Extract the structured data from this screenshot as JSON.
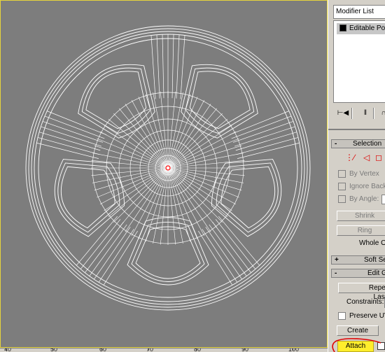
{
  "viewport": {
    "ruler_labels": [
      "40",
      "50",
      "60",
      "70",
      "80",
      "90",
      "100"
    ],
    "line_color": "#ffffff",
    "background": "#7d7d7d",
    "pivot_color": "#ff0000",
    "border_color": "#e6d43c"
  },
  "command_panel": {
    "modifier_list": {
      "label": "Modifier List"
    },
    "modifier_stack": {
      "item_label": "Editable Poly"
    },
    "toolbar_icons": [
      "pin-stack-icon",
      "show-end-result-icon",
      "make-unique-icon"
    ],
    "selection_rollout": {
      "toggle": "-",
      "title": "Selection",
      "by_vertex": "By Vertex",
      "ignore_backfacing": "Ignore Backfacing",
      "by_angle": "By Angle:",
      "shrink": "Shrink",
      "ring": "Ring",
      "whole_object": "Whole Object Selected"
    },
    "soft_selection_rollout": {
      "toggle": "+",
      "title": "Soft Selection"
    },
    "edit_geometry_rollout": {
      "toggle": "-",
      "title": "Edit Geometry",
      "repeat_last": "Repeat Last",
      "constraints_label": "Constraints:",
      "preserve_uvs": "Preserve UVs",
      "create": "Create",
      "attach": "Attach"
    },
    "highlight_color": "#ffee2c",
    "annotation_color": "#e00000"
  }
}
